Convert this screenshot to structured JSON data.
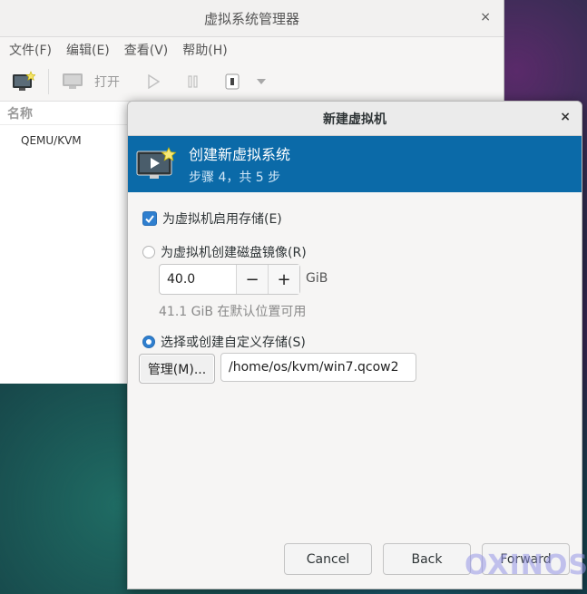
{
  "manager": {
    "title": "虚拟系统管理器",
    "close": "×",
    "menu": [
      "文件(F)",
      "编辑(E)",
      "查看(V)",
      "帮助(H)"
    ],
    "toolbar": {
      "open_label": "打开"
    },
    "list_header": "名称",
    "connection": "QEMU/KVM"
  },
  "dialog": {
    "title": "新建虚拟机",
    "close": "×",
    "banner_title": "创建新虚拟系统",
    "banner_step": "步骤 4，共 5 步",
    "enable_storage_label": "为虚拟机启用存储(E)",
    "enable_storage_checked": true,
    "create_disk_label": "为虚拟机创建磁盘镜像(R)",
    "disk_size": "40.0",
    "disk_unit": "GiB",
    "minus": "−",
    "plus": "+",
    "available_hint": "41.1 GiB 在默认位置可用",
    "custom_storage_label": "选择或创建自定义存储(S)",
    "selected_option": "custom_storage",
    "manage_button": "管理(M)...",
    "path_value": "/home/os/kvm/win7.qcow2",
    "cancel": "Cancel",
    "back": "Back",
    "forward": "Forward"
  },
  "watermark": "OXINOS",
  "colors": {
    "banner": "#0b6aa8",
    "accent": "#2f7fcf"
  }
}
